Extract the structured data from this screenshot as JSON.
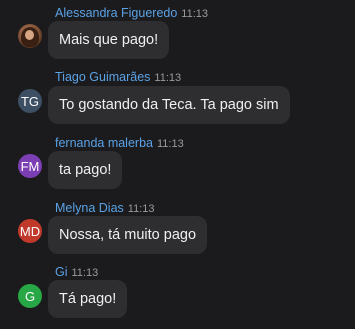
{
  "messages": [
    {
      "author": "Alessandra Figueredo",
      "time": "11:13",
      "text": "Mais que pago!",
      "avatar": {
        "type": "photo",
        "initials": ""
      }
    },
    {
      "author": "Tiago Guimarães",
      "time": "11:13",
      "text": "To gostando da Teca. Ta pago sim",
      "avatar": {
        "type": "initials",
        "initials": "TG",
        "color": "#3d4f63"
      }
    },
    {
      "author": "fernanda malerba",
      "time": "11:13",
      "text": "ta pago!",
      "avatar": {
        "type": "initials",
        "initials": "FM",
        "color": "#7c3fb3"
      }
    },
    {
      "author": "Melyna Dias",
      "time": "11:13",
      "text": "Nossa, tá muito pago",
      "avatar": {
        "type": "initials",
        "initials": "MD",
        "color": "#c0392b"
      }
    },
    {
      "author": "Gi",
      "time": "11:13",
      "text": "Tá pago!",
      "avatar": {
        "type": "initials",
        "initials": "G",
        "color": "#27a745"
      }
    }
  ],
  "colors": {
    "background": "#1b1b1d",
    "bubble": "#2e2e31",
    "author_name": "#5aa2e6",
    "timestamp": "#9a9aa0"
  }
}
